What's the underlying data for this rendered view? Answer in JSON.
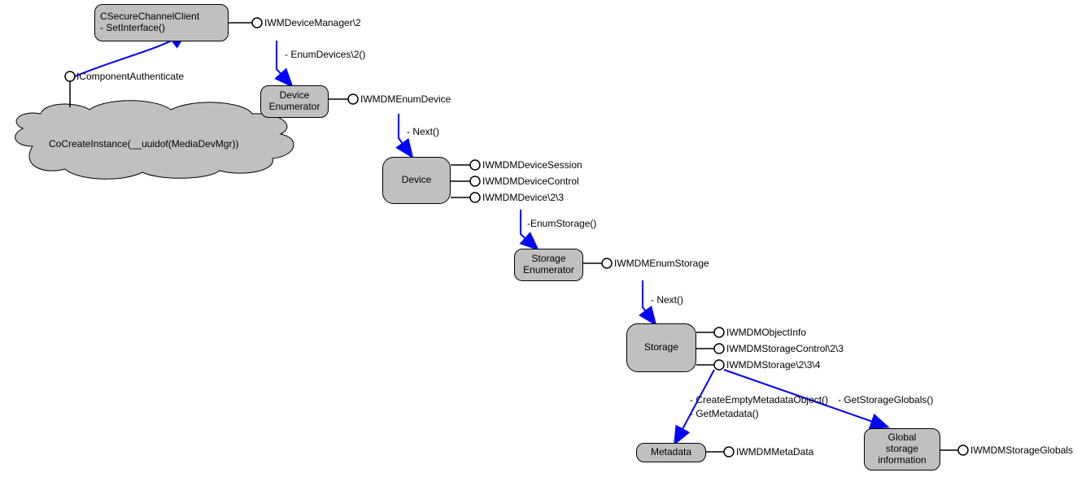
{
  "nodes": {
    "secureClient": {
      "line1": "CSecureChannelClient",
      "line2": "- SetInterface()"
    },
    "cloud": "CoCreateInstance(__uuidof(MediaDevMgr))",
    "deviceEnum": {
      "line1": "Device",
      "line2": "Enumerator"
    },
    "device": "Device",
    "storageEnum": {
      "line1": "Storage",
      "line2": "Enumerator"
    },
    "storage": "Storage",
    "metadata": "Metadata",
    "globalStorage": {
      "line1": "Global",
      "line2": "storage",
      "line3": "information"
    }
  },
  "interfaces": {
    "icomponentAuthenticate": "IComponentAuthenticate",
    "iwmDeviceManager": "IWMDeviceManager\\2",
    "iwmdmEnumDevice": "IWMDMEnumDevice",
    "iwmdmDeviceSession": "IWMDMDeviceSession",
    "iwmdmDeviceControl": "IWMDMDeviceControl",
    "iwmdmDevice": "IWMDMDevice\\2\\3",
    "iwmdmEnumStorage": "IWMDMEnumStorage",
    "iwmdmObjectInfo": "IWMDMObjectInfo",
    "iwmdmStorageControl": "IWMDMStorageControl\\2\\3",
    "iwmdmStorage": "IWMDMStorage\\2\\3\\4",
    "iwmdmMetaData": "IWMDMMetaData",
    "iwmdmStorageGlobals": "IWMDMStorageGlobals"
  },
  "edges": {
    "enumDevices": "- EnumDevices\\2()",
    "next1": "- Next()",
    "enumStorage": "-EnumStorage()",
    "next2": "- Next()",
    "createEmptyMeta": "- CreateEmptyMetadataObject()",
    "getMetadata": "- GetMetadata()",
    "getStorageGlobals": "- GetStorageGlobals()"
  }
}
